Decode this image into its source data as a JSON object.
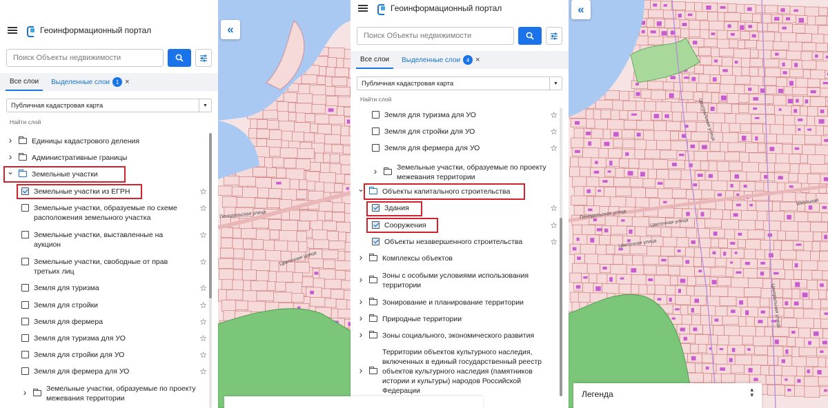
{
  "app": {
    "title": "Геоинформационный портал"
  },
  "search": {
    "placeholder": "Поиск Объекты недвижимости"
  },
  "tabs": {
    "all_layers": "Все слои",
    "selected_layers": "Выделенные слои"
  },
  "panelA": {
    "selected_count": "1",
    "basemap": "Публичная кадастровая карта",
    "find_label": "Найти слой",
    "rows": [
      {
        "type": "folder",
        "label": "Единицы кадастрового деления"
      },
      {
        "type": "folder",
        "label": "Административные границы"
      },
      {
        "type": "folder-open",
        "label": "Земельные участки",
        "highlight": true
      },
      {
        "type": "layer",
        "label": "Земельные участки из ЕГРН",
        "checked": true,
        "highlight": true
      },
      {
        "type": "layer",
        "label": "Земельные участки, образуемые по схеме",
        "label2": "расположения земельного участка",
        "checked": false
      },
      {
        "type": "layer",
        "label": "Земельные участки, выставленные на",
        "label2": "аукцион",
        "checked": false
      },
      {
        "type": "layer",
        "label": "Земельные участки, свободные от прав",
        "label2": "третьих лиц",
        "checked": false
      },
      {
        "type": "layer",
        "label": "Земля для туризма",
        "checked": false
      },
      {
        "type": "layer",
        "label": "Земля для стройки",
        "checked": false
      },
      {
        "type": "layer",
        "label": "Земля для фермера",
        "checked": false
      },
      {
        "type": "layer",
        "label": "Земля для туризма для УО",
        "checked": false
      },
      {
        "type": "layer",
        "label": "Земля для стройки для УО",
        "checked": false
      },
      {
        "type": "layer",
        "label": "Земля для фермера для УО",
        "checked": false
      },
      {
        "type": "subfolder",
        "label": "Земельные участки, образуемые по проекту",
        "label2": "межевания территории"
      }
    ]
  },
  "panelB": {
    "selected_count": "4",
    "basemap": "Публичная кадастровая карта",
    "find_label": "Найти слой",
    "rows": [
      {
        "type": "layer",
        "label": "Земля для туризма для УО",
        "checked": false
      },
      {
        "type": "layer",
        "label": "Земля для стройки для УО",
        "checked": false
      },
      {
        "type": "layer",
        "label": "Земля для фермера для УО",
        "checked": false
      },
      {
        "type": "subfolder",
        "label": "Земельные участки, образуемые по проекту",
        "label2": "межевания территории"
      },
      {
        "type": "folder-open",
        "label": "Объекты капитального строительства",
        "highlight": true
      },
      {
        "type": "layer",
        "label": "Здания",
        "checked": true,
        "highlight": true
      },
      {
        "type": "layer",
        "label": "Сооружения",
        "checked": true,
        "highlight": true
      },
      {
        "type": "layer",
        "label": "Объекты незавершенного строительства",
        "checked": true
      },
      {
        "type": "folder",
        "label": "Комплексы объектов"
      },
      {
        "type": "folder",
        "label": "Зоны с особыми условиями использования",
        "label2": "территории"
      },
      {
        "type": "folder",
        "label": "Зонирование и планирование территории"
      },
      {
        "type": "folder",
        "label": "Природные территории"
      },
      {
        "type": "folder",
        "label": "Зоны социального, экономического развития"
      },
      {
        "type": "folder",
        "label": "Территории объектов культурного наследия,",
        "label2": "включенных в единый государственный реестр",
        "label3": "объектов культурного наследия (памятников",
        "label4": "истории и культуры) народов Российской",
        "label5": "Федерации"
      }
    ]
  },
  "map": {
    "streets": [
      "Пенодольская улица",
      "Цветочная улица",
      "Пенодольская улица",
      "Цветочная улица",
      "Цветочная улица",
      "Центральная улица",
      "Центральная улица",
      "Школьная"
    ],
    "colors": {
      "water": "#a9c8f2",
      "park": "#7cc67a",
      "parcel_fill": "#f6dada",
      "parcel_line": "#cf7f7f",
      "building": "#c85ad2",
      "panel_accent": "#1a73e8",
      "highlight": "#d3212c"
    }
  },
  "legend": {
    "title": "Легенда"
  }
}
